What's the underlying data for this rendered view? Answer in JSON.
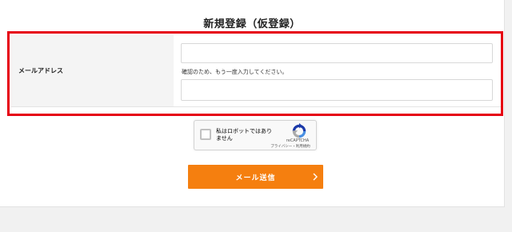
{
  "page": {
    "title": "新規登録（仮登録）"
  },
  "form": {
    "email_label": "メールアドレス",
    "email_value": "",
    "confirm_hint": "確認のため、もう一度入力してください。",
    "confirm_value": ""
  },
  "recaptcha": {
    "checkbox_label": "私はロボットではありません",
    "brand": "reCAPTCHA",
    "links": "プライバシー・利用規約",
    "logo_icon": "recaptcha-logo-icon"
  },
  "submit": {
    "label": "メール送信",
    "arrow_icon": "chevron-right-icon"
  },
  "colors": {
    "highlight": "#e60012",
    "accent": "#f57f0f",
    "label_bg": "#f4f4f4"
  }
}
